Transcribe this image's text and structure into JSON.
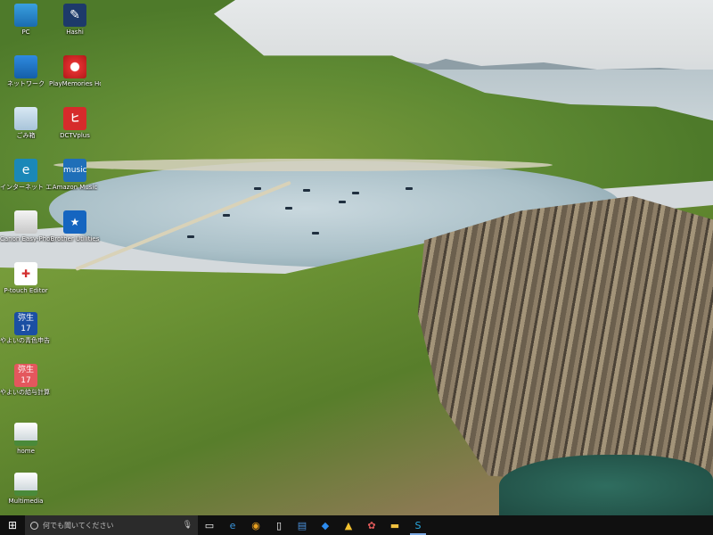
{
  "desktop": {
    "icons": [
      {
        "label": "PC",
        "icon": "pc-icon"
      },
      {
        "label": "Hashi",
        "icon": "hashi-app-icon"
      },
      {
        "label": "ネットワーク",
        "icon": "network-icon"
      },
      {
        "label": "PlayMemories Home",
        "icon": "playmemories-icon"
      },
      {
        "label": "ごみ箱",
        "icon": "recycle-bin-icon"
      },
      {
        "label": "DCTVplus",
        "icon": "dctv-icon"
      },
      {
        "label": "インターネット エクスプローラー",
        "icon": "internet-explorer-icon"
      },
      {
        "label": "Amazon Music",
        "icon": "amazon-music-icon"
      },
      {
        "label": "Canon Easy-PhotoPrint",
        "icon": "canon-easy-photoprint-icon"
      },
      {
        "label": "Brother Utilities",
        "icon": "brother-utilities-icon"
      },
      {
        "label": "P-touch Editor",
        "icon": "p-touch-icon"
      },
      {
        "label": "やよいの青色申告 17",
        "icon": "yayoi-blue-icon"
      },
      {
        "label": "やよいの給与計算 17",
        "icon": "yayoi-red-icon"
      },
      {
        "label": "home",
        "icon": "home-folder-icon"
      },
      {
        "label": "Multimedia",
        "icon": "multimedia-folder-icon"
      }
    ],
    "wallpaper": "coastal-cove-landscape"
  },
  "taskbar": {
    "start_icon": "windows-start-icon",
    "search_placeholder": "何でも聞いてください",
    "items": [
      {
        "icon": "task-view-icon",
        "glyph": "▭"
      },
      {
        "icon": "edge-icon",
        "glyph": "e"
      },
      {
        "icon": "chrome-icon",
        "glyph": "◉"
      },
      {
        "icon": "file-icon",
        "glyph": "▯"
      },
      {
        "icon": "document-icon",
        "glyph": "▤"
      },
      {
        "icon": "dropbox-icon",
        "glyph": "◆"
      },
      {
        "icon": "google-drive-icon",
        "glyph": "▲"
      },
      {
        "icon": "photos-icon",
        "glyph": "✿"
      },
      {
        "icon": "file-explorer-icon",
        "glyph": "▬"
      },
      {
        "icon": "skype-icon",
        "glyph": "S"
      }
    ]
  },
  "colors": {
    "taskbar_bg": "#101010",
    "search_bg": "#2b2b2b",
    "accent": "#7aa7e0"
  }
}
